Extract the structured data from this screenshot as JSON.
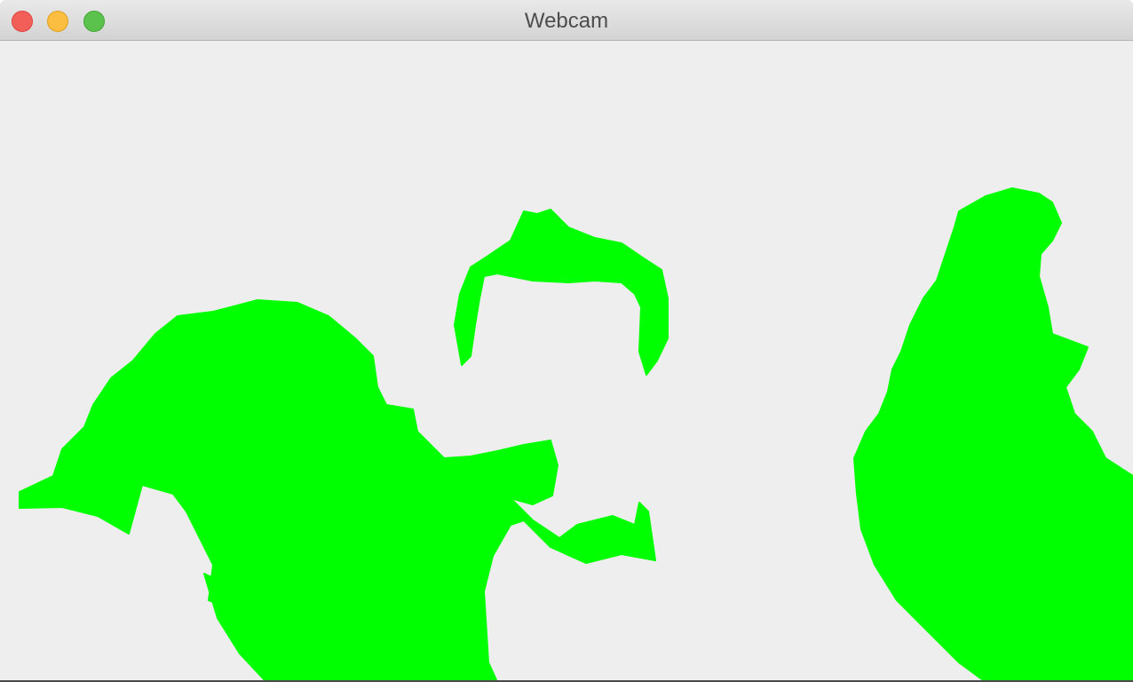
{
  "window": {
    "title": "Webcam"
  },
  "controls": {
    "close": "close",
    "minimize": "minimize",
    "zoom": "zoom"
  },
  "feed": {
    "mask_color": "#00ff00",
    "background_color": "#eeeeee"
  }
}
